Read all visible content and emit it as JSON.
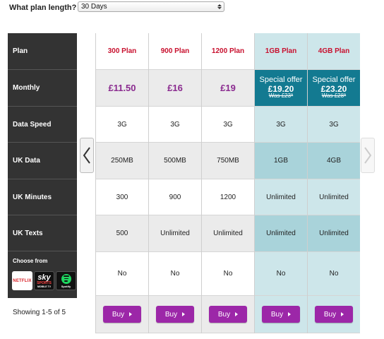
{
  "plan_length": {
    "label": "What plan length?",
    "selected": "30 Days"
  },
  "row_labels": [
    "Plan",
    "Monthly",
    "Data Speed",
    "UK Data",
    "UK Minutes",
    "UK Texts"
  ],
  "choose_from": {
    "label": "Choose from",
    "services": [
      {
        "name": "NETFLIX",
        "icon": "netflix-logo"
      },
      {
        "name": "sky",
        "sub": "SPORTS",
        "tv": "MOBILE TV",
        "icon": "sky-sports-logo"
      },
      {
        "name": "Spotify",
        "icon": "spotify-logo"
      }
    ]
  },
  "showing": "Showing 1-5 of 5",
  "plans": [
    {
      "name": "300 Plan",
      "monthly": "£11.50",
      "speed": "3G",
      "data": "250MB",
      "minutes": "300",
      "texts": "500",
      "choose": "No",
      "buy": "Buy"
    },
    {
      "name": "900 Plan",
      "monthly": "£16",
      "speed": "3G",
      "data": "500MB",
      "minutes": "900",
      "texts": "Unlimited",
      "choose": "No",
      "buy": "Buy"
    },
    {
      "name": "1200 Plan",
      "monthly": "£19",
      "speed": "3G",
      "data": "750MB",
      "minutes": "1200",
      "texts": "Unlimited",
      "choose": "No",
      "buy": "Buy"
    },
    {
      "name": "1GB Plan",
      "offer_tag": "Special offer",
      "offer_price": "£19.20",
      "offer_was": "Was £23*",
      "speed": "3G",
      "data": "1GB",
      "minutes": "Unlimited",
      "texts": "Unlimited",
      "choose": "No",
      "buy": "Buy"
    },
    {
      "name": "4GB Plan",
      "offer_tag": "Special offer",
      "offer_price": "£23.20",
      "offer_was": "Was £28*",
      "speed": "3G",
      "data": "4GB",
      "minutes": "Unlimited",
      "texts": "Unlimited",
      "choose": "No",
      "buy": "Buy"
    }
  ],
  "colors": {
    "label_column": "#333333",
    "plan_name": "#c8102e",
    "price": "#8a2a8f",
    "offer_background": "#137a91",
    "premium_light": "#cde6ea",
    "premium_dark": "#a9d3da",
    "buy_button": "#9c27a8"
  }
}
